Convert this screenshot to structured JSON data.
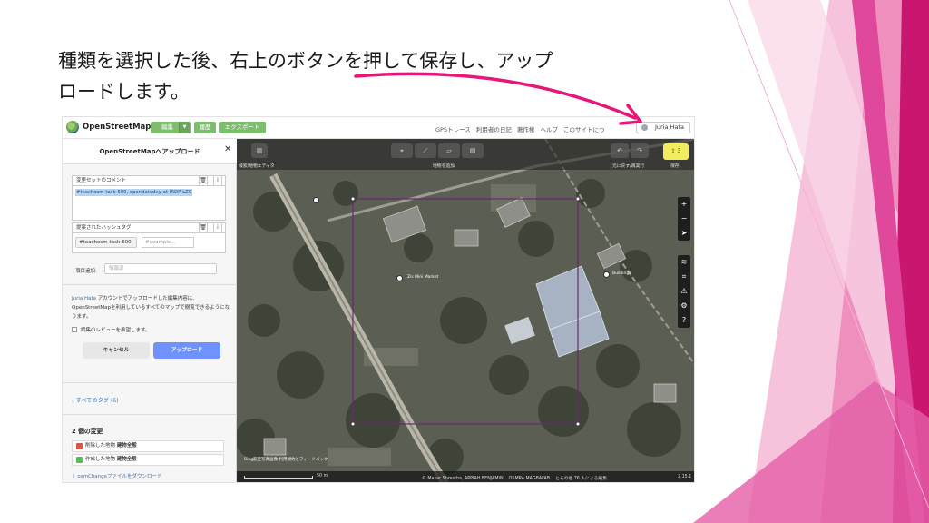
{
  "slide": {
    "title_line1": "種類を選択した後、右上のボタンを押して保存し、アップ",
    "title_line2": "ロードします。",
    "accent_color": "#e6167a"
  },
  "navbar": {
    "brand": "OpenStreetMap",
    "edit": "編集",
    "history": "履歴",
    "export": "エクスポート",
    "links": "GPSトレース 利用者の日記 著作権 ヘルプ このサイトにつ",
    "user": "Juria Hata"
  },
  "panel": {
    "title": "OpenStreetMapへアップロード",
    "close": "✕",
    "comment_label": "変更セットのコメント",
    "comment_value": "#teachosm-task-600, opendataday-at-IRDP-LZC",
    "hashtag_label": "提案されたハッシュタグ",
    "hashtag_chip": "#teachosm-task-600",
    "hashtag_placeholder": "#example...",
    "add_field_label": "項目追加:",
    "add_field_placeholder": "情報源",
    "info_user": "Juria Hata",
    "info_text": " アカウントでアップロードした編集内容は、OpenStreetMapを利用しているすべてのマップで閲覧できるようになります。",
    "review_label": "編集のレビューを希望します。",
    "cancel": "キャンセル",
    "upload": "アップロード",
    "all_tags": "すべてのタグ (6)",
    "changes_title": "2 個の変更",
    "changes": [
      {
        "type": "削除した地物",
        "name": "建物全般",
        "color": "#d9534f"
      },
      {
        "type": "作成した地物",
        "name": "建物全般",
        "color": "#5cb85c"
      }
    ],
    "download": "osmChangeファイルをダウンロード"
  },
  "map": {
    "panel_btn_label": "検索/地物エディタ",
    "add_label": "地物を追加",
    "undo_label": "元に戻す/再実行",
    "save_label": "保存",
    "save_count": "3",
    "poi_market": "Zis Mini Market",
    "poi_building": "Buildings",
    "scale": "50 m",
    "attribution": "© Maxar Shrestha, APPIAH BENJAMIN... OSMRA MAGBAFAB... とその他 76 人による編集",
    "version": "2.15.1",
    "imagery": "Bing航空写真画像 利用規約とフィードバック"
  }
}
